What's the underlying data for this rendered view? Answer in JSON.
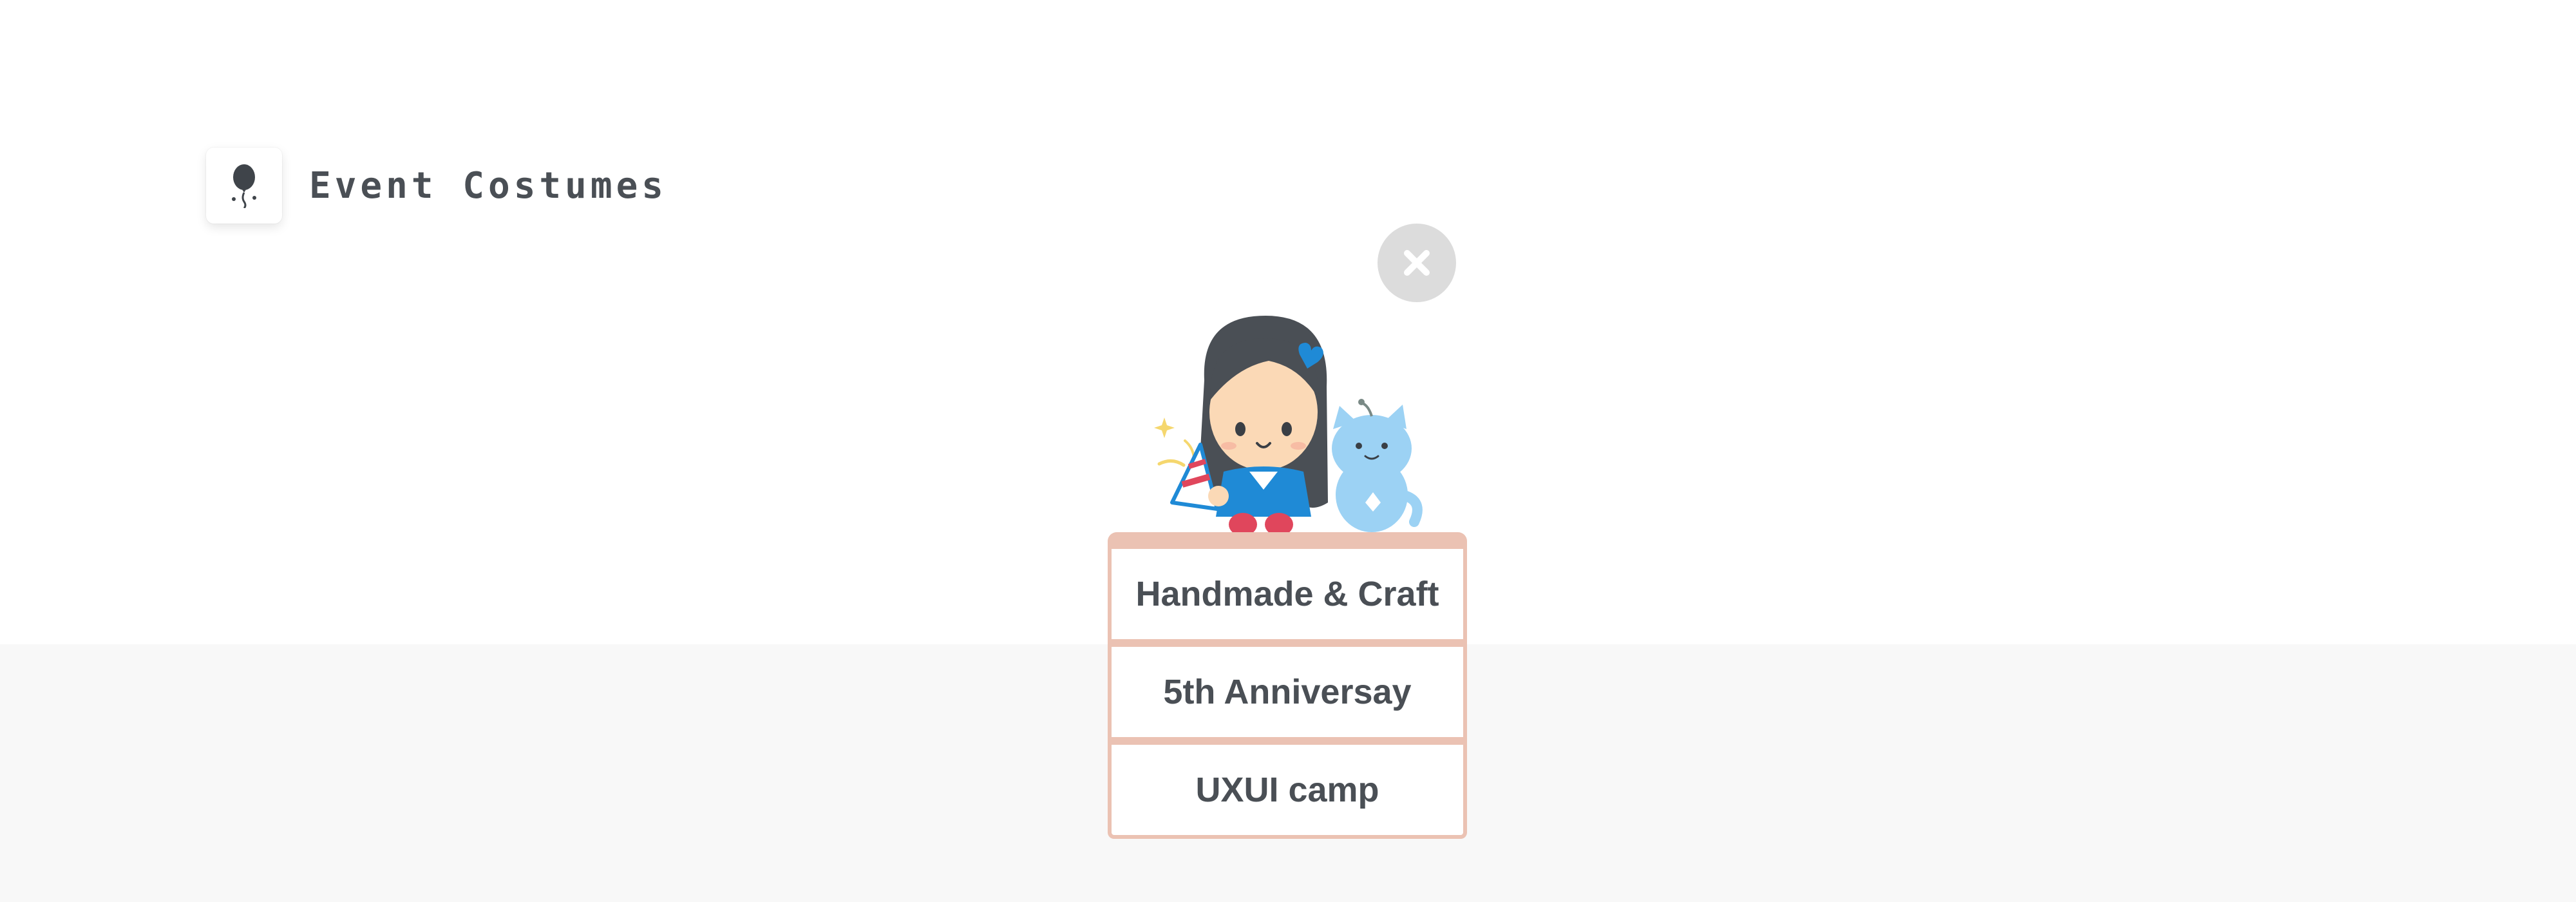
{
  "header": {
    "title": "Event Costumes",
    "logo_icon": "balloon-icon"
  },
  "close_button": {
    "icon": "close-icon"
  },
  "illustration": {
    "subject": "girl-with-cat-icon"
  },
  "menu": {
    "items": [
      {
        "label": "Handmade & Craft"
      },
      {
        "label": "5th Anniversay"
      },
      {
        "label": "UXUI camp"
      }
    ]
  },
  "colors": {
    "text": "#4a4f55",
    "card_border": "#ebc2b3",
    "close_bg": "#dcdcdc",
    "band_bg": "#f8f8f8"
  }
}
